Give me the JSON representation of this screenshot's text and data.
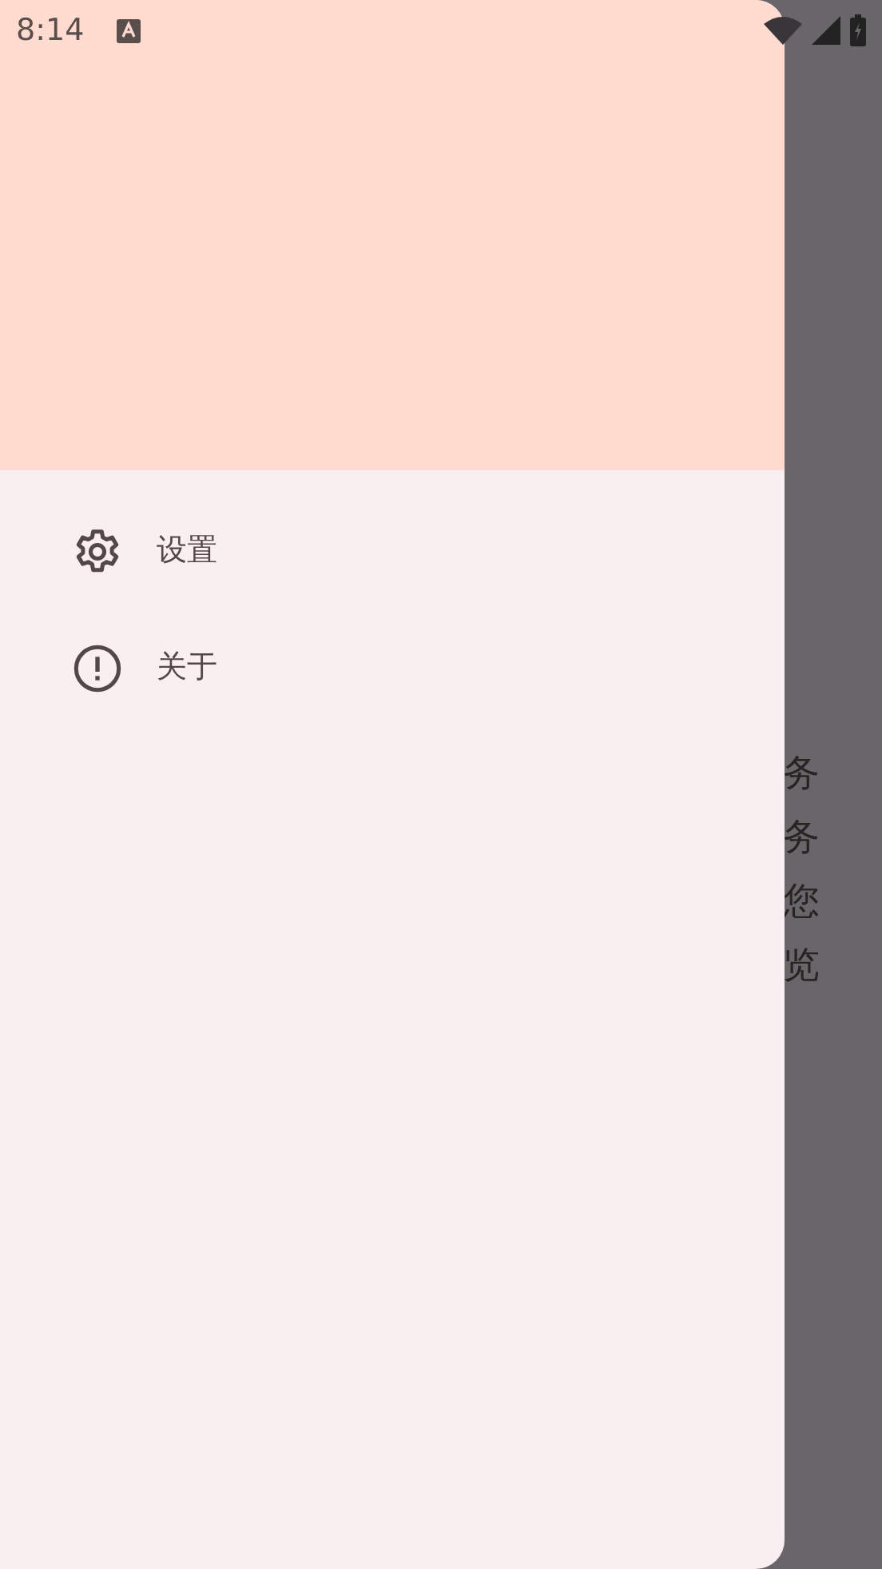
{
  "status_bar": {
    "time": "8:14"
  },
  "background_text": [
    "务",
    "务",
    "您",
    "览"
  ],
  "drawer": {
    "items": [
      {
        "kind": "settings",
        "label": "设置"
      },
      {
        "kind": "about",
        "label": "关于"
      }
    ]
  }
}
